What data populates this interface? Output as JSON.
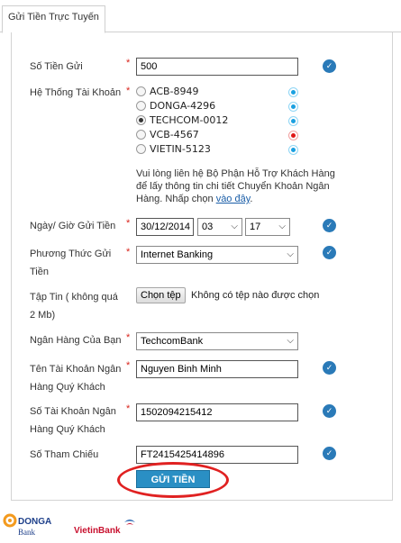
{
  "tab": {
    "label": "Gửi Tiền Trực Tuyến"
  },
  "form": {
    "amount": {
      "label": "Số Tiền Gửi",
      "value": "500"
    },
    "account_system": {
      "label": "Hệ Thống Tài Khoản",
      "options": [
        {
          "label": "ACB-8949",
          "selected": false,
          "status": "blue"
        },
        {
          "label": "DONGA-4296",
          "selected": false,
          "status": "blue"
        },
        {
          "label": "TECHCOM-0012",
          "selected": true,
          "status": "blue"
        },
        {
          "label": "VCB-4567",
          "selected": false,
          "status": "red"
        },
        {
          "label": "VIETIN-5123",
          "selected": false,
          "status": "blue"
        }
      ],
      "note": "Vui lòng liên hệ Bộ Phận Hỗ Trợ Khách Hàng để lấy thông tin chi tiết Chuyển Khoản Ngân Hàng. Nhấp chọn",
      "note_link": "vào đây",
      "note_end": "."
    },
    "datetime": {
      "label": "Ngày/ Giờ Gửi Tiền",
      "date": "30/12/2014",
      "hour": "03",
      "minute": "17"
    },
    "method": {
      "label": "Phương Thức Gửi Tiền",
      "value": "Internet Banking"
    },
    "file": {
      "label": "Tập Tin ( không quá 2 Mb)",
      "button": "Chọn tệp",
      "status": "Không có tệp nào được chọn"
    },
    "bank": {
      "label": "Ngân Hàng Của Bạn",
      "value": "TechcomBank"
    },
    "account_name": {
      "label": "Tên Tài Khoản Ngân Hàng Quý Khách",
      "value": "Nguyen Binh Minh"
    },
    "account_number": {
      "label": "Số Tài Khoản Ngân Hàng Quý Khách",
      "value": "1502094215412"
    },
    "reference": {
      "label": "Số Tham Chiếu",
      "value": "FT2415425414896"
    },
    "required_mark": "*",
    "submit": "GỬI TIỀN"
  },
  "logos": {
    "donga_top": "DONGA",
    "donga_bottom": "Bank",
    "vietin": "VietinBank"
  },
  "colors": {
    "accent": "#2a8fc4",
    "check": "#2a7ab8",
    "required": "#d9241c",
    "highlight_ring": "#e02121"
  }
}
